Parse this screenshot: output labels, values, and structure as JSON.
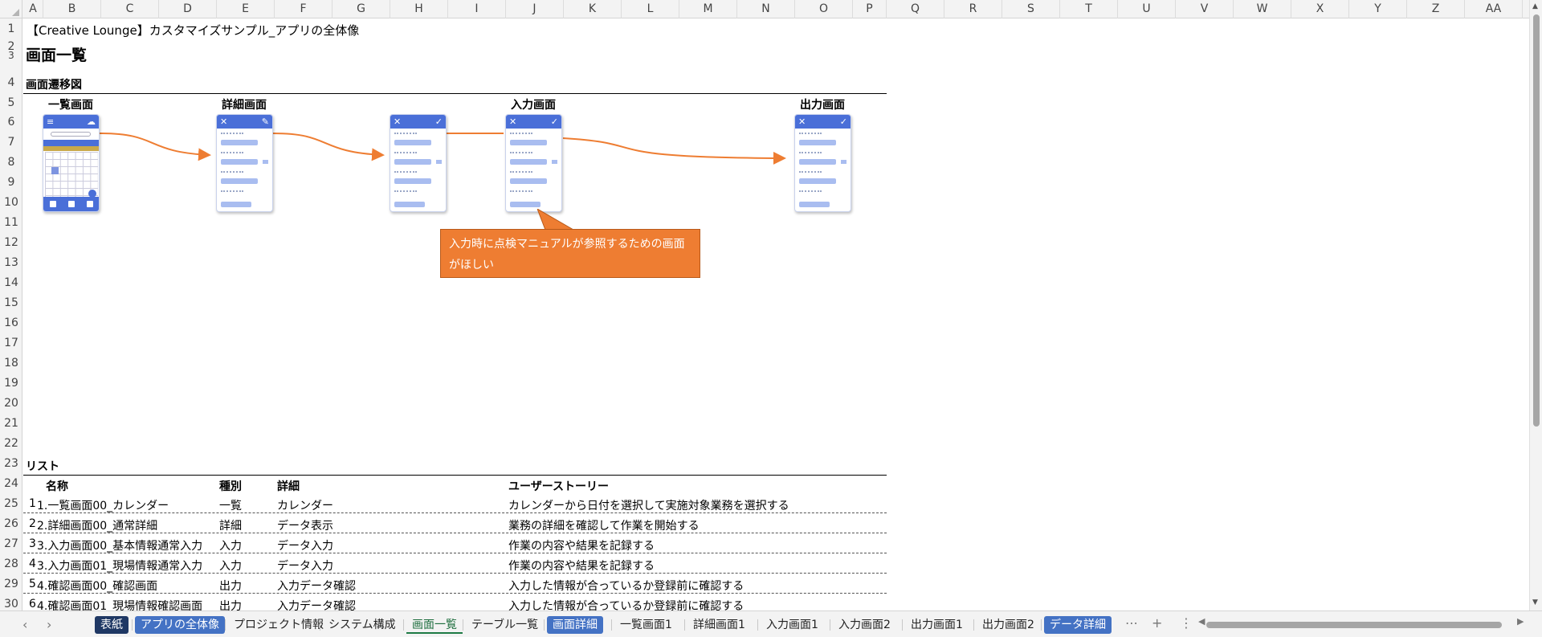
{
  "columns": [
    "A",
    "B",
    "C",
    "D",
    "E",
    "F",
    "G",
    "H",
    "I",
    "J",
    "K",
    "L",
    "M",
    "N",
    "O",
    "P",
    "Q",
    "R",
    "S",
    "T",
    "U",
    "V",
    "W",
    "X",
    "Y",
    "Z",
    "AA"
  ],
  "rows": [
    "1",
    "2",
    "3",
    "4",
    "5",
    "6",
    "7",
    "8",
    "9",
    "10",
    "11",
    "12",
    "13",
    "14",
    "15",
    "16",
    "17",
    "18",
    "19",
    "20",
    "21",
    "22",
    "23",
    "24",
    "25",
    "26",
    "27",
    "28",
    "29",
    "30"
  ],
  "sheet": {
    "doc_title": "【Creative Lounge】カスタマイズサンプル_アプリの全体像",
    "heading": "画面一覧",
    "transition_label": "画面遷移図",
    "screens": [
      "一覧画面",
      "詳細画面",
      "入力画面",
      "出力画面"
    ],
    "callout": "入力時に点検マニュアルが参照するための画面がほしい",
    "list_label": "リスト",
    "list_headers": {
      "name": "名称",
      "kind": "種別",
      "detail": "詳細",
      "story": "ユーザーストーリー"
    },
    "list_rows": [
      {
        "no": "1",
        "name": "1.一覧画面00_カレンダー",
        "kind": "一覧",
        "detail": "カレンダー",
        "story": "カレンダーから日付を選択して実施対象業務を選択する"
      },
      {
        "no": "2",
        "name": "2.詳細画面00_通常詳細",
        "kind": "詳細",
        "detail": "データ表示",
        "story": "業務の詳細を確認して作業を開始する"
      },
      {
        "no": "3",
        "name": "3.入力画面00_基本情報通常入力",
        "kind": "入力",
        "detail": "データ入力",
        "story": "作業の内容や結果を記録する"
      },
      {
        "no": "4",
        "name": "3.入力画面01_現場情報通常入力",
        "kind": "入力",
        "detail": "データ入力",
        "story": "作業の内容や結果を記録する"
      },
      {
        "no": "5",
        "name": "4.確認画面00_確認画面",
        "kind": "出力",
        "detail": "入力データ確認",
        "story": "入力した情報が合っているか登録前に確認する"
      },
      {
        "no": "6",
        "name": "4.確認画面01_現場情報確認画面",
        "kind": "出力",
        "detail": "入力データ確認",
        "story": "入力した情報が合っているか登録前に確認する"
      }
    ]
  },
  "tabs": {
    "items": [
      {
        "label": "表紙",
        "style": "dark"
      },
      {
        "label": "アプリの全体像",
        "style": "colored"
      },
      {
        "label": "プロジェクト情報",
        "style": "plain"
      },
      {
        "label": "システム構成",
        "style": "plain"
      },
      {
        "label": "画面一覧",
        "style": "active"
      },
      {
        "label": "テーブル一覧",
        "style": "plain"
      },
      {
        "label": "画面詳細",
        "style": "colored"
      },
      {
        "label": "一覧画面1",
        "style": "plain"
      },
      {
        "label": "詳細画面1",
        "style": "plain"
      },
      {
        "label": "入力画面1",
        "style": "plain"
      },
      {
        "label": "入力画面2",
        "style": "plain"
      },
      {
        "label": "出力画面1",
        "style": "plain"
      },
      {
        "label": "出力画面2",
        "style": "plain"
      },
      {
        "label": "データ詳細",
        "style": "colored"
      }
    ],
    "more": "⋯",
    "add": "+",
    "options": "⋮",
    "prev": "‹",
    "next": "›"
  },
  "colors": {
    "accent": "#4472c4",
    "arrow": "#ee7d32",
    "phone_bar": "#4a6fd8"
  }
}
